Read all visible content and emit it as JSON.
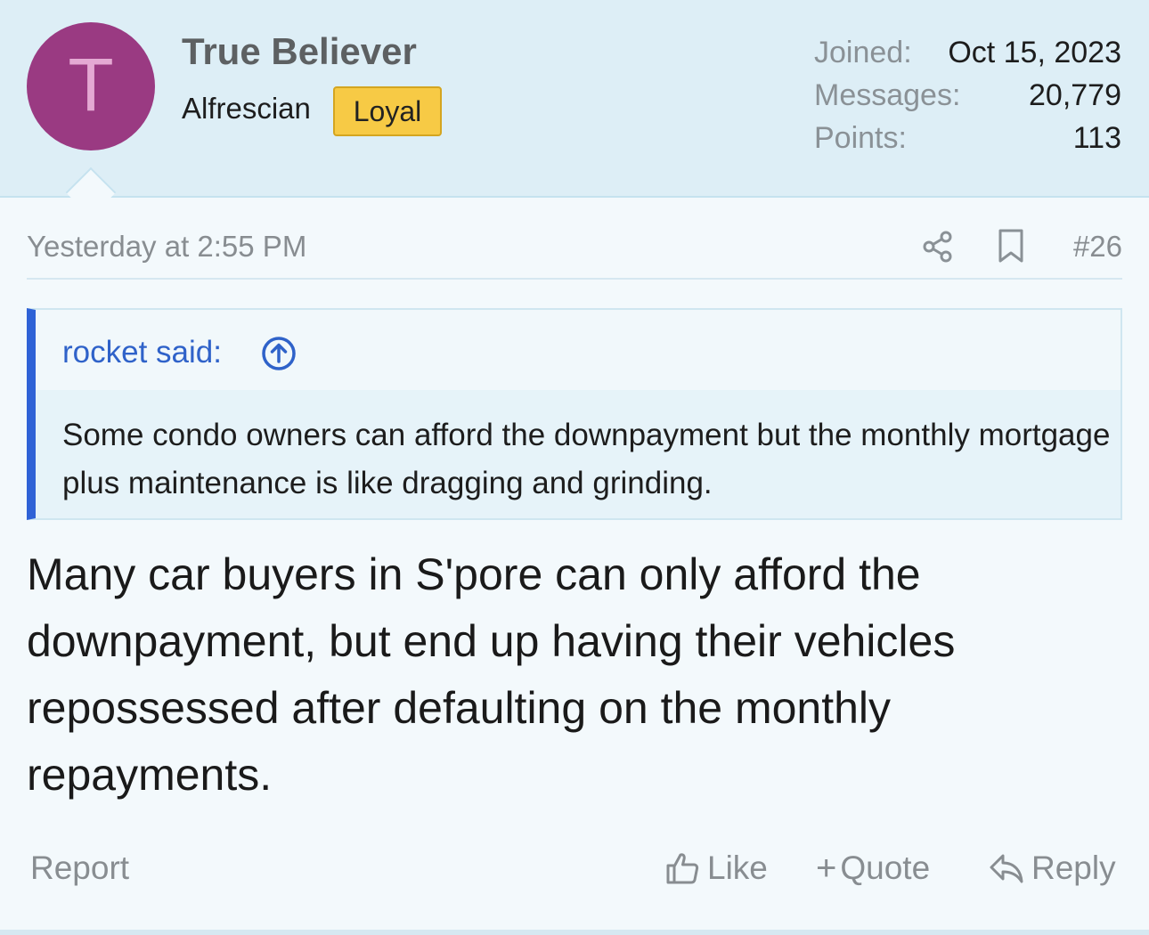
{
  "user": {
    "avatar_letter": "T",
    "name": "True Believer",
    "title": "Alfrescian",
    "badge": "Loyal",
    "stats": [
      {
        "label": "Joined:",
        "value": "Oct 15, 2023"
      },
      {
        "label": "Messages:",
        "value": "20,779"
      },
      {
        "label": "Points:",
        "value": "113"
      }
    ]
  },
  "post": {
    "date": "Yesterday at 2:55 PM",
    "number": "#26",
    "icons": {
      "share": "share-icon",
      "bookmark": "bookmark-icon"
    }
  },
  "quote": {
    "author": "rocket said:",
    "body": "Some condo owners can afford the downpayment but the monthly mortgage plus maintenance is like dragging and grinding."
  },
  "message": {
    "body": "Many car buyers in S'pore can only afford the downpayment, but end up having their vehicles repossessed after defaulting on the monthly repayments."
  },
  "actions": {
    "report": "Report",
    "like": "Like",
    "quote": "Quote",
    "reply": "Reply"
  },
  "colors": {
    "header_bg": "#ddeef6",
    "avatar_bg": "#9a3a82",
    "badge_bg": "#f7ca45",
    "quote_accent": "#2f62d6",
    "link": "#2f62c9",
    "muted": "#888d91"
  }
}
